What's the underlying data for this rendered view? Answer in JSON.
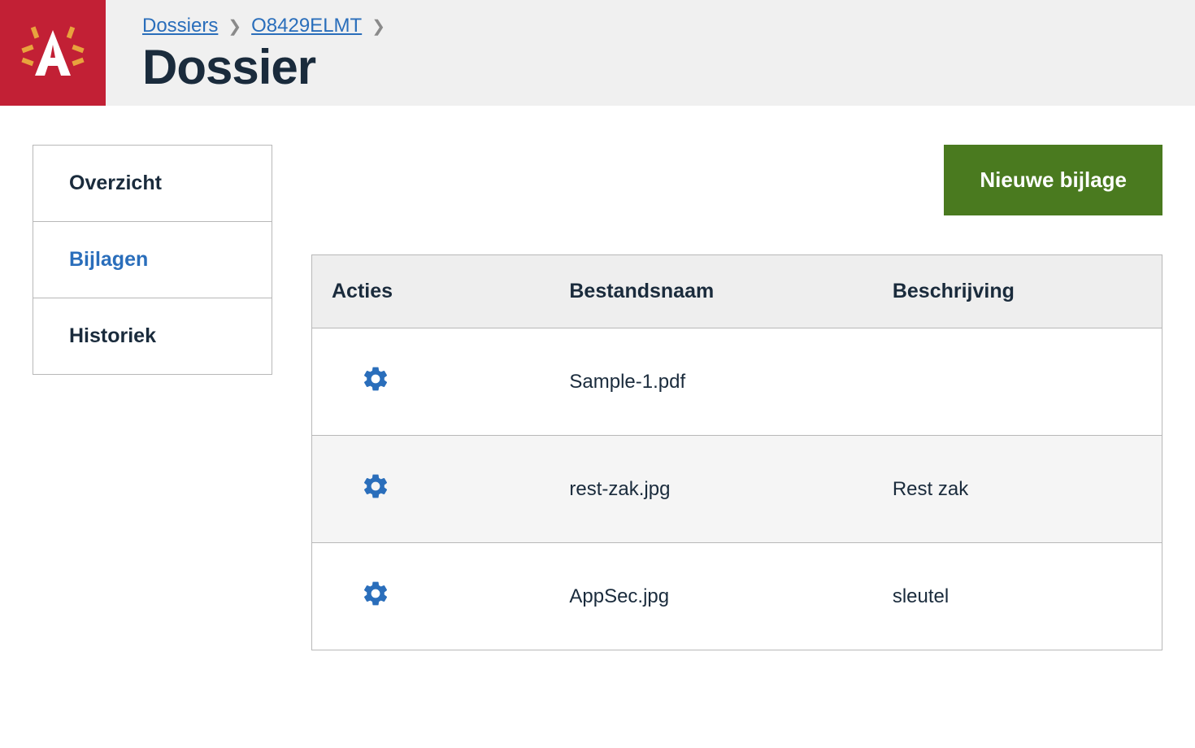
{
  "breadcrumb": {
    "items": [
      {
        "label": "Dossiers"
      },
      {
        "label": "O8429ELMT"
      }
    ]
  },
  "page": {
    "title": "Dossier"
  },
  "sidebar": {
    "items": [
      {
        "label": "Overzicht",
        "active": false
      },
      {
        "label": "Bijlagen",
        "active": true
      },
      {
        "label": "Historiek",
        "active": false
      }
    ]
  },
  "toolbar": {
    "new_attachment_label": "Nieuwe bijlage"
  },
  "table": {
    "headers": {
      "actions": "Acties",
      "filename": "Bestandsnaam",
      "description": "Beschrijving"
    },
    "rows": [
      {
        "filename": "Sample-1.pdf",
        "description": ""
      },
      {
        "filename": "rest-zak.jpg",
        "description": "Rest zak"
      },
      {
        "filename": "AppSec.jpg",
        "description": "sleutel"
      }
    ]
  }
}
